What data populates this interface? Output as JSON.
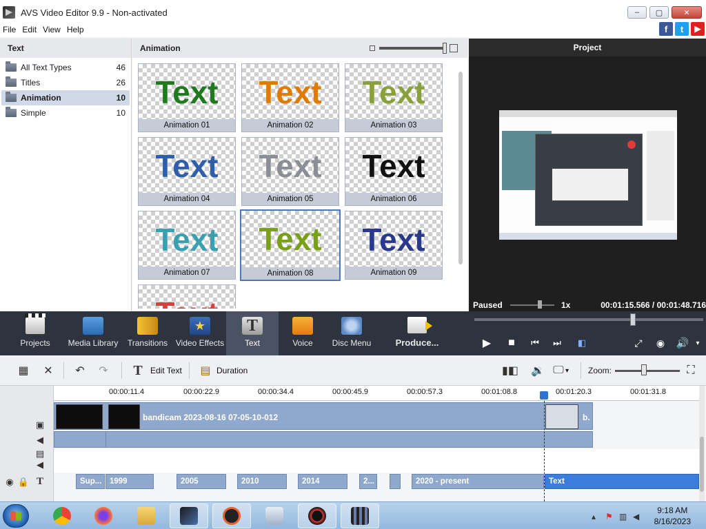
{
  "window": {
    "title": "AVS Video Editor 9.9 - Non-activated"
  },
  "menu": [
    "File",
    "Edit",
    "View",
    "Help"
  ],
  "social": {
    "facebook": "f",
    "twitter": "t",
    "youtube": "▶"
  },
  "left_panel": {
    "header": "Text",
    "items": [
      {
        "label": "All Text Types",
        "count": "46"
      },
      {
        "label": "Titles",
        "count": "26"
      },
      {
        "label": "Animation",
        "count": "10"
      },
      {
        "label": "Simple",
        "count": "10"
      }
    ]
  },
  "gallery": {
    "header": "Animation",
    "tiles": [
      {
        "caption": "Animation 01",
        "sample": "Text",
        "color": "#1f7a1f"
      },
      {
        "caption": "Animation 02",
        "sample": "Text",
        "color": "#e07b00"
      },
      {
        "caption": "Animation 03",
        "sample": "Text",
        "color": "#8aa03a"
      },
      {
        "caption": "Animation 04",
        "sample": "Text",
        "color": "#2f5fa8"
      },
      {
        "caption": "Animation 05",
        "sample": "Text",
        "color": "#8a8f96"
      },
      {
        "caption": "Animation 06",
        "sample": "Text",
        "color": "#111111"
      },
      {
        "caption": "Animation 07",
        "sample": "Text",
        "color": "#3aa0b0"
      },
      {
        "caption": "Animation 08",
        "sample": "Text",
        "color": "#7aa01a"
      },
      {
        "caption": "Animation 09",
        "sample": "Text",
        "color": "#2a3a8a"
      },
      {
        "caption": "",
        "sample": "Text",
        "color": "#d84040"
      }
    ]
  },
  "project": {
    "header": "Project",
    "status": "Paused",
    "speed": "1x",
    "time": "00:01:15.566  / 00:01:48.716"
  },
  "toolbar": {
    "projects": "Projects",
    "media_library": "Media Library",
    "transitions": "Transitions",
    "video_effects": "Video Effects",
    "text": "Text",
    "voice": "Voice",
    "disc_menu": "Disc Menu",
    "produce": "Produce..."
  },
  "edit_bar": {
    "edit_text": "Edit Text",
    "duration": "Duration",
    "zoom_label": "Zoom:"
  },
  "timeline": {
    "ticks": [
      "00:00:11.4",
      "00:00:22.9",
      "00:00:34.4",
      "00:00:45.9",
      "00:00:57.3",
      "00:01:08.8",
      "00:01:20.3",
      "00:01:31.8"
    ],
    "clip_name": "bandicam 2023-08-16 07-05-10-012",
    "clip_end_label": "b.",
    "text_segments": [
      "Sup...",
      "1999",
      "2005",
      "2010",
      "2014",
      "2...",
      "",
      "2020 - present",
      "Text"
    ]
  },
  "taskbar": {
    "time": "9:18 AM",
    "date": "8/16/2023"
  }
}
